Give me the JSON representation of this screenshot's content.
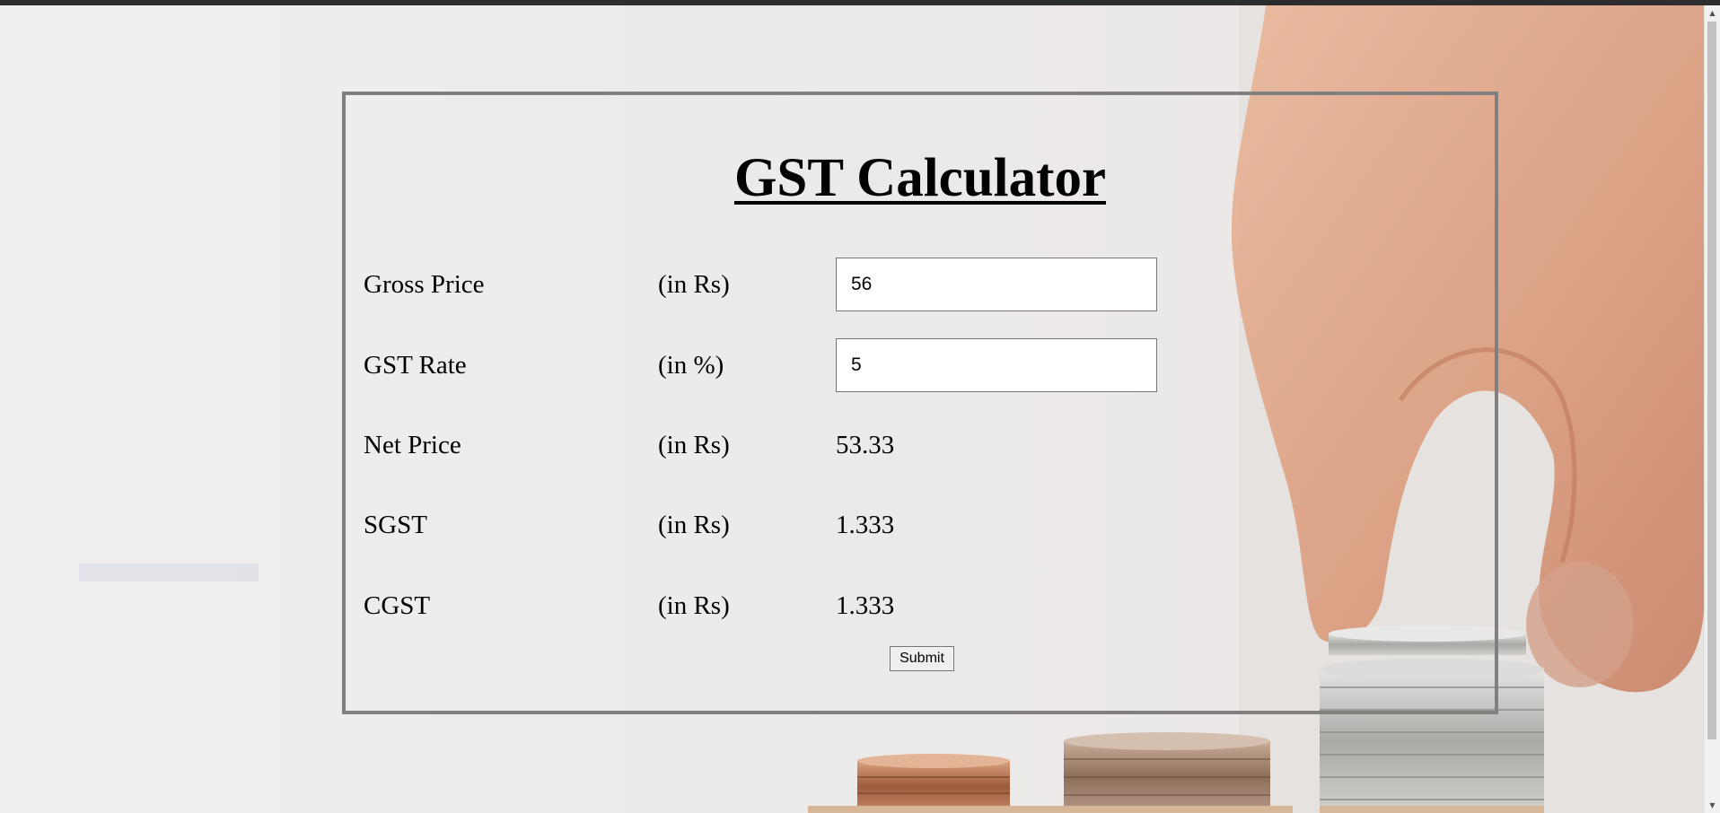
{
  "calculator": {
    "title": "GST Calculator",
    "rows": [
      {
        "label": "Gross Price",
        "unit": "(in Rs)",
        "value": "56"
      },
      {
        "label": "GST Rate",
        "unit": "(in %)",
        "value": "5"
      },
      {
        "label": "Net Price",
        "unit": "(in Rs)",
        "value": "53.33"
      },
      {
        "label": "SGST",
        "unit": "(in Rs)",
        "value": "1.333"
      },
      {
        "label": "CGST",
        "unit": "(in Rs)",
        "value": "1.333"
      }
    ],
    "submit_label": "Submit"
  },
  "colors": {
    "frame_border": "#808080",
    "background": "#edebea",
    "text": "#000000"
  },
  "icons": {
    "scroll_up": "scroll-up-arrow-icon",
    "scroll_down": "scroll-down-arrow-icon"
  }
}
